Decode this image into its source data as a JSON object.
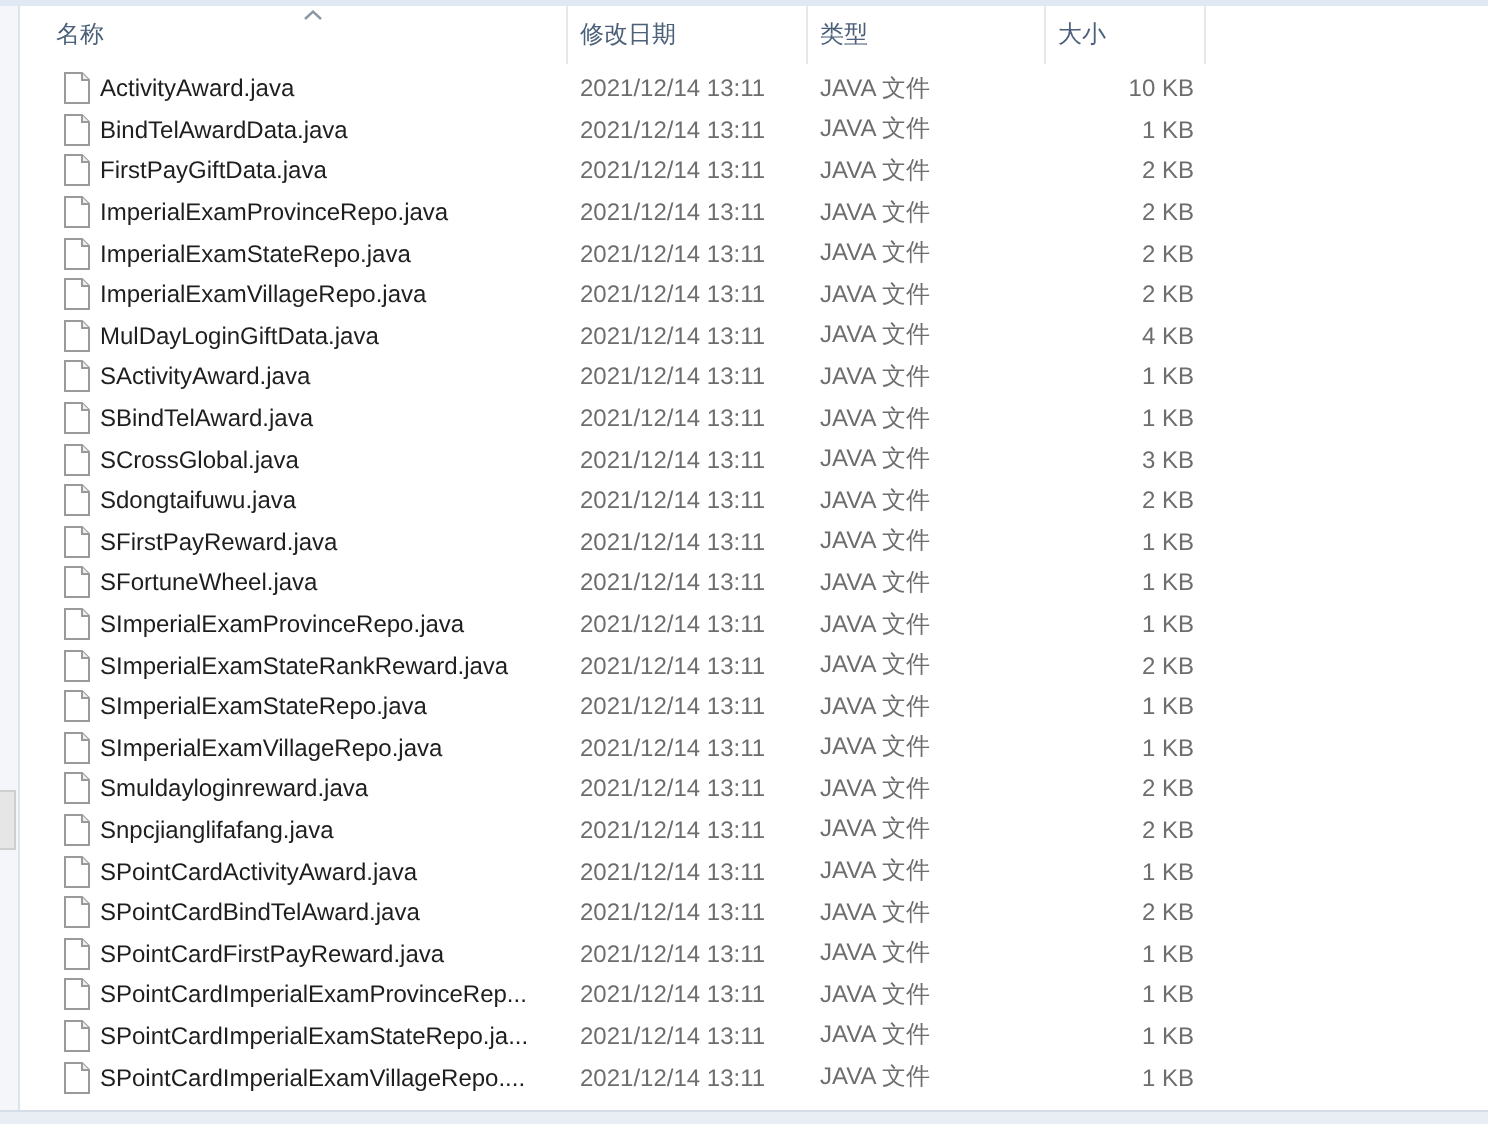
{
  "columns": [
    {
      "label": "名称",
      "sorted": true
    },
    {
      "label": "修改日期",
      "sorted": false
    },
    {
      "label": "类型",
      "sorted": false
    },
    {
      "label": "大小",
      "sorted": false
    }
  ],
  "files": [
    {
      "name": "ActivityAward.java",
      "date": "2021/12/14 13:11",
      "type": "JAVA 文件",
      "size": "10 KB"
    },
    {
      "name": "BindTelAwardData.java",
      "date": "2021/12/14 13:11",
      "type": "JAVA 文件",
      "size": "1 KB"
    },
    {
      "name": "FirstPayGiftData.java",
      "date": "2021/12/14 13:11",
      "type": "JAVA 文件",
      "size": "2 KB"
    },
    {
      "name": "ImperialExamProvinceRepo.java",
      "date": "2021/12/14 13:11",
      "type": "JAVA 文件",
      "size": "2 KB"
    },
    {
      "name": "ImperialExamStateRepo.java",
      "date": "2021/12/14 13:11",
      "type": "JAVA 文件",
      "size": "2 KB"
    },
    {
      "name": "ImperialExamVillageRepo.java",
      "date": "2021/12/14 13:11",
      "type": "JAVA 文件",
      "size": "2 KB"
    },
    {
      "name": "MulDayLoginGiftData.java",
      "date": "2021/12/14 13:11",
      "type": "JAVA 文件",
      "size": "4 KB"
    },
    {
      "name": "SActivityAward.java",
      "date": "2021/12/14 13:11",
      "type": "JAVA 文件",
      "size": "1 KB"
    },
    {
      "name": "SBindTelAward.java",
      "date": "2021/12/14 13:11",
      "type": "JAVA 文件",
      "size": "1 KB"
    },
    {
      "name": "SCrossGlobal.java",
      "date": "2021/12/14 13:11",
      "type": "JAVA 文件",
      "size": "3 KB"
    },
    {
      "name": "Sdongtaifuwu.java",
      "date": "2021/12/14 13:11",
      "type": "JAVA 文件",
      "size": "2 KB"
    },
    {
      "name": "SFirstPayReward.java",
      "date": "2021/12/14 13:11",
      "type": "JAVA 文件",
      "size": "1 KB"
    },
    {
      "name": "SFortuneWheel.java",
      "date": "2021/12/14 13:11",
      "type": "JAVA 文件",
      "size": "1 KB"
    },
    {
      "name": "SImperialExamProvinceRepo.java",
      "date": "2021/12/14 13:11",
      "type": "JAVA 文件",
      "size": "1 KB"
    },
    {
      "name": "SImperialExamStateRankReward.java",
      "date": "2021/12/14 13:11",
      "type": "JAVA 文件",
      "size": "2 KB"
    },
    {
      "name": "SImperialExamStateRepo.java",
      "date": "2021/12/14 13:11",
      "type": "JAVA 文件",
      "size": "1 KB"
    },
    {
      "name": "SImperialExamVillageRepo.java",
      "date": "2021/12/14 13:11",
      "type": "JAVA 文件",
      "size": "1 KB"
    },
    {
      "name": "Smuldayloginreward.java",
      "date": "2021/12/14 13:11",
      "type": "JAVA 文件",
      "size": "2 KB"
    },
    {
      "name": "Snpcjianglifafang.java",
      "date": "2021/12/14 13:11",
      "type": "JAVA 文件",
      "size": "2 KB"
    },
    {
      "name": "SPointCardActivityAward.java",
      "date": "2021/12/14 13:11",
      "type": "JAVA 文件",
      "size": "1 KB"
    },
    {
      "name": "SPointCardBindTelAward.java",
      "date": "2021/12/14 13:11",
      "type": "JAVA 文件",
      "size": "2 KB"
    },
    {
      "name": "SPointCardFirstPayReward.java",
      "date": "2021/12/14 13:11",
      "type": "JAVA 文件",
      "size": "1 KB"
    },
    {
      "name": "SPointCardImperialExamProvinceRep...",
      "date": "2021/12/14 13:11",
      "type": "JAVA 文件",
      "size": "1 KB"
    },
    {
      "name": "SPointCardImperialExamStateRepo.ja...",
      "date": "2021/12/14 13:11",
      "type": "JAVA 文件",
      "size": "1 KB"
    },
    {
      "name": "SPointCardImperialExamVillageRepo....",
      "date": "2021/12/14 13:11",
      "type": "JAVA 文件",
      "size": "1 KB"
    }
  ]
}
